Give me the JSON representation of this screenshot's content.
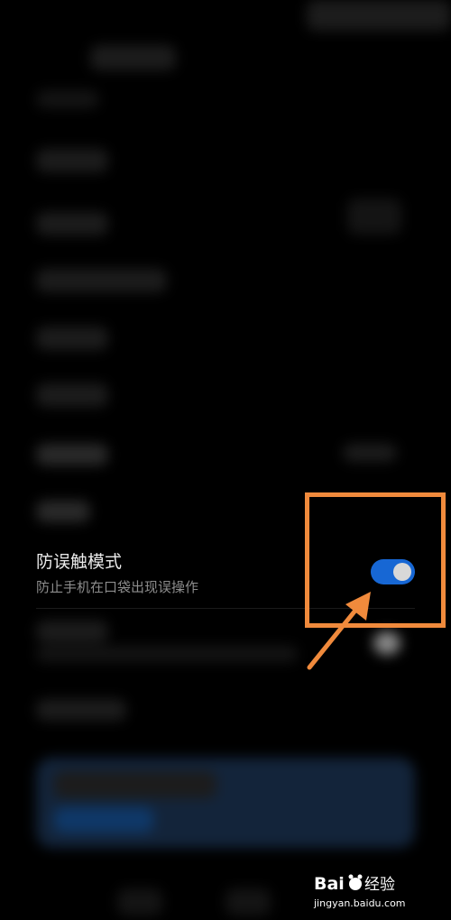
{
  "setting": {
    "title": "防误触模式",
    "subtitle": "防止手机在口袋出现误操作",
    "enabled": true
  },
  "annotation": {
    "box_color": "#f08a3c",
    "arrow_color": "#f08a3c"
  },
  "colors": {
    "background": "#000000",
    "toggle_on": "#1767d4",
    "knob": "#d8d8d8"
  },
  "watermark": {
    "brand": "Bai",
    "brand_suffix": "经验",
    "domain": "jingyan.baidu.com"
  }
}
